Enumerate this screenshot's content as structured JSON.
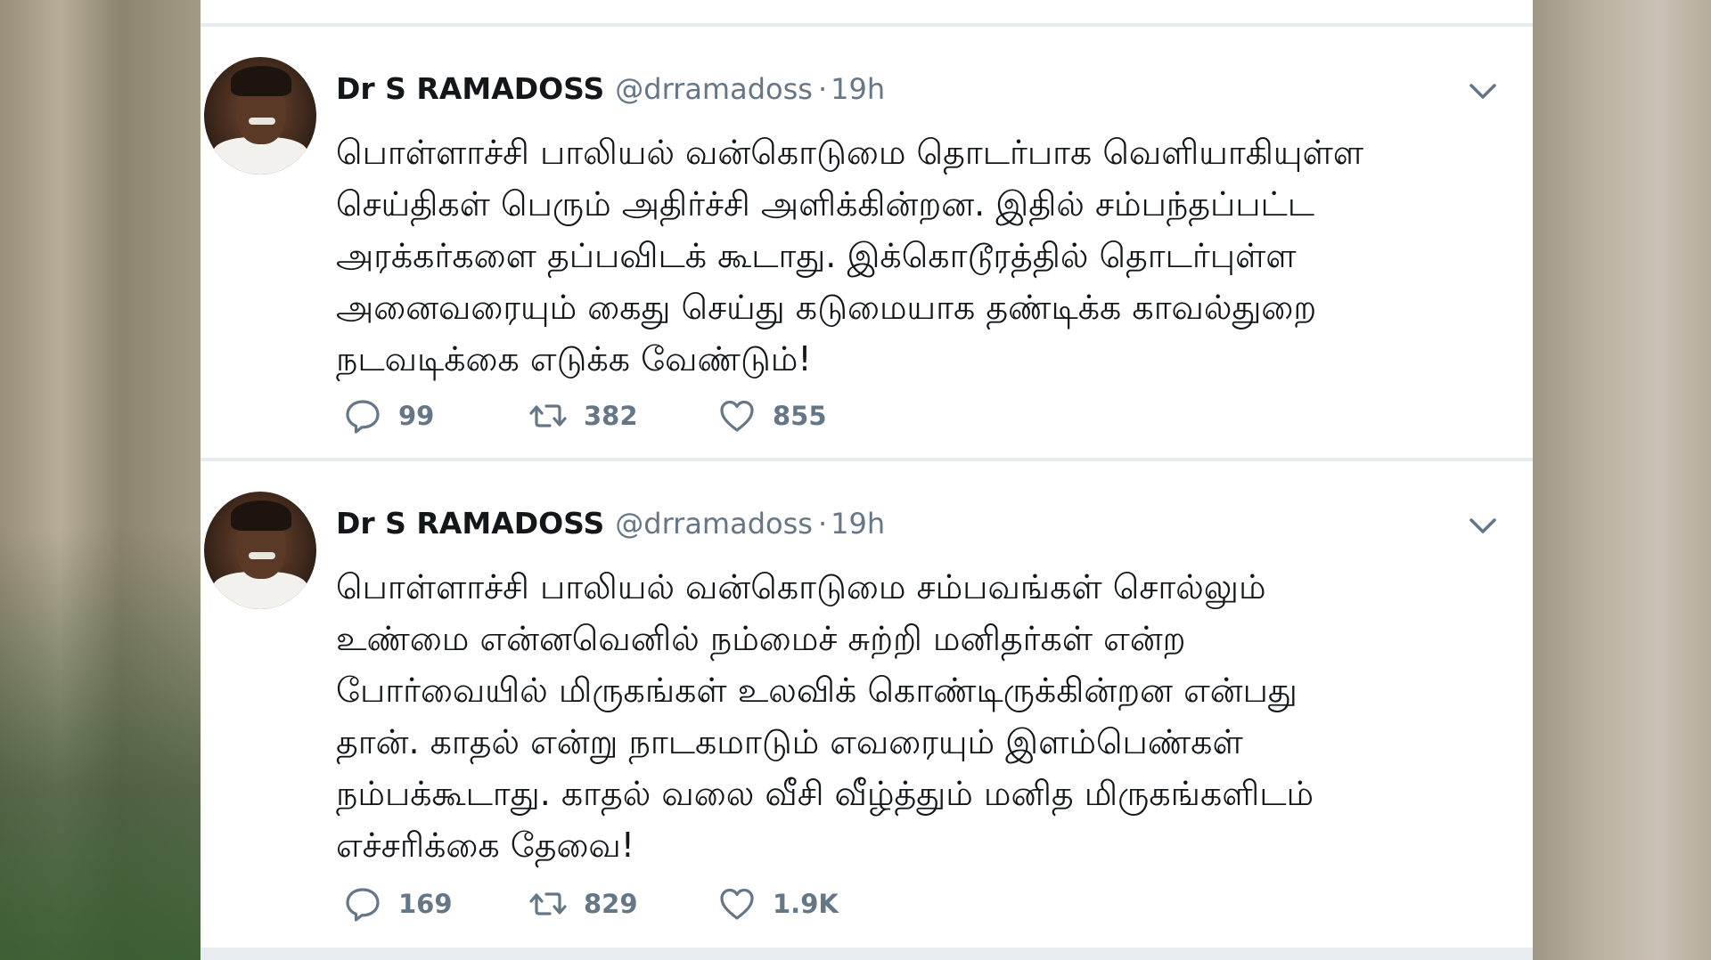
{
  "tweets": [
    {
      "author": "Dr S RAMADOSS",
      "handle": "@drramadoss",
      "separator": "·",
      "time": "19h",
      "lines": [
        "பொள்ளாச்சி பாலியல் வன்கொடுமை தொடர்பாக வெளியாகியுள்ள",
        "செய்திகள் பெரும் அதிர்ச்சி அளிக்கின்றன. இதில் சம்பந்தப்பட்ட",
        "அரக்கர்களை தப்பவிடக் கூடாது. இக்கொடூரத்தில் தொடர்புள்ள",
        "அனைவரையும் கைது செய்து கடுமையாக தண்டிக்க காவல்துறை",
        "நடவடிக்கை எடுக்க வேண்டும்!"
      ],
      "replies": "99",
      "retweets": "382",
      "likes": "855"
    },
    {
      "author": "Dr S RAMADOSS",
      "handle": "@drramadoss",
      "separator": "·",
      "time": "19h",
      "lines": [
        "பொள்ளாச்சி பாலியல் வன்கொடுமை சம்பவங்கள் சொல்லும்",
        "உண்மை என்னவெனில் நம்மைச் சுற்றி மனிதர்கள் என்ற",
        "போர்வையில் மிருகங்கள் உலவிக் கொண்டிருக்கின்றன என்பது",
        "தான். காதல் என்று நாடகமாடும் எவரையும் இளம்பெண்கள்",
        "நம்பக்கூடாது. காதல் வலை வீசி வீழ்த்தும் மனித மிருகங்களிடம்",
        "எச்சரிக்கை தேவை!"
      ],
      "replies": "169",
      "retweets": "829",
      "likes": "1.9K"
    }
  ],
  "icons": {
    "reply": "reply-icon",
    "retweet": "retweet-icon",
    "like": "heart-icon",
    "menu": "chevron-down-icon"
  },
  "colors": {
    "text": "#14171a",
    "secondary": "#657786",
    "divider": "#e6ecf0"
  }
}
